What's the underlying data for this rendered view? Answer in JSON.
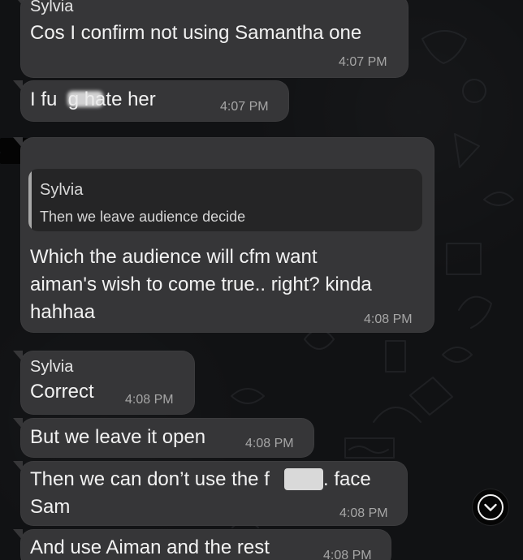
{
  "messages": [
    {
      "sender": "Sylvia",
      "text": "Cos I confirm not using Samantha one",
      "time": "4:07 PM"
    },
    {
      "text": "I fu  g hate her",
      "time": "4:07 PM"
    },
    {
      "quoted_sender": "Sylvia",
      "quoted_text": "Then we leave audience decide",
      "text": "Which the audience will cfm want\naiman's wish to come true.. right? kinda\nhahhaa",
      "time": "4:08 PM"
    },
    {
      "sender": "Sylvia",
      "text": "Correct",
      "time": "4:08 PM"
    },
    {
      "text": "But we leave it open",
      "time": "4:08 PM"
    },
    {
      "text_part_1": "Then we can don’t use the f",
      "text_part_2": ". face",
      "text_line_2": "Sam",
      "time": "4:08 PM"
    },
    {
      "text": "And use Aiman and the rest",
      "time": "4:08 PM"
    }
  ],
  "icons": {
    "scroll_down": "chevron-down-icon"
  },
  "colors": {
    "background": "#111214",
    "bubble": "#363638",
    "quote_box": "#252526",
    "timestamp": "#a6a6a6"
  }
}
